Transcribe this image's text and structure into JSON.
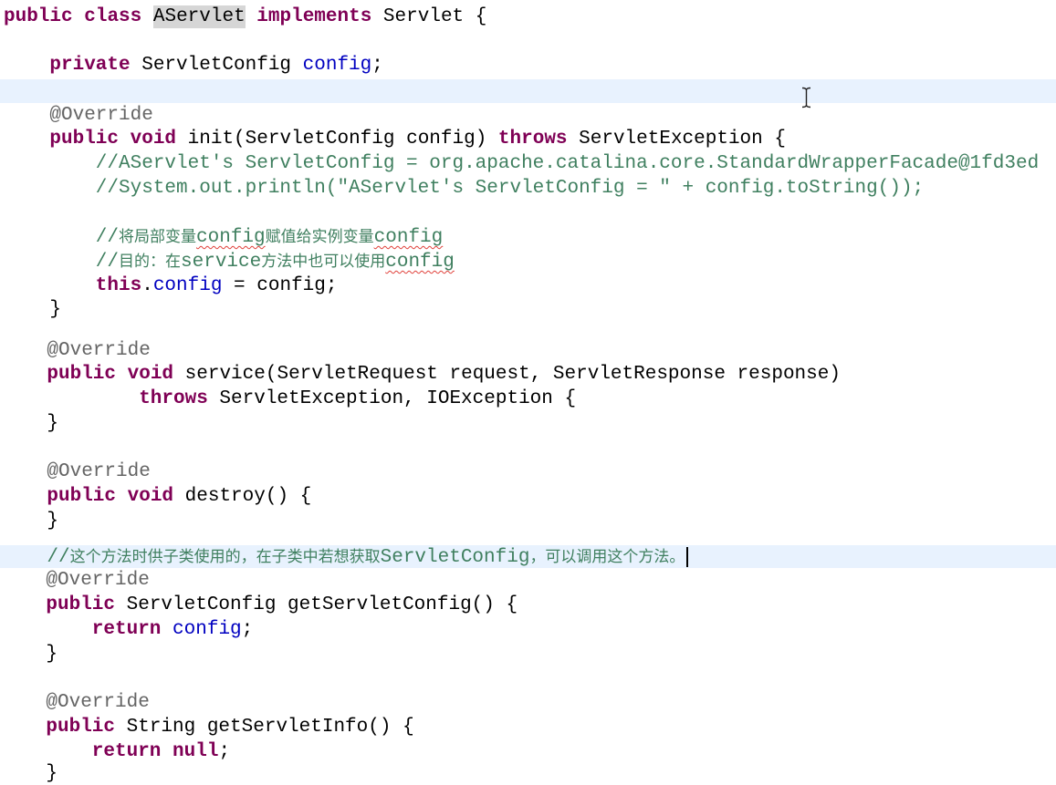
{
  "colors": {
    "keyword": "#7f0055",
    "plain": "#000000",
    "field": "#0000c0",
    "comment": "#3f7f5f",
    "annotation": "#646464",
    "current_line": "#e8f2fe",
    "occurrence_highlight": "#d6d6d6",
    "spell_error": "#e0403a"
  },
  "mouse_cursor_icon": "ibeam-cursor-icon",
  "lines": [
    {
      "tokens": [
        {
          "type": "keyword",
          "text": "public"
        },
        {
          "type": "plain",
          "text": " "
        },
        {
          "type": "keyword",
          "text": "class"
        },
        {
          "type": "plain",
          "text": " "
        },
        {
          "type": "plain",
          "text": "AServlet",
          "mark": true
        },
        {
          "type": "plain",
          "text": " "
        },
        {
          "type": "keyword",
          "text": "implements"
        },
        {
          "type": "plain",
          "text": " Servlet {"
        }
      ]
    },
    {
      "tokens": [
        {
          "type": "keyword",
          "text": "private"
        },
        {
          "type": "plain",
          "text": " ServletConfig "
        },
        {
          "type": "field",
          "text": "config"
        },
        {
          "type": "plain",
          "text": ";"
        }
      ]
    },
    {
      "tokens": [
        {
          "type": "annotation",
          "text": "@Override"
        }
      ]
    },
    {
      "tokens": [
        {
          "type": "keyword",
          "text": "public"
        },
        {
          "type": "plain",
          "text": " "
        },
        {
          "type": "keyword",
          "text": "void"
        },
        {
          "type": "plain",
          "text": " init(ServletConfig config) "
        },
        {
          "type": "keyword",
          "text": "throws"
        },
        {
          "type": "plain",
          "text": " ServletException {"
        }
      ]
    },
    {
      "tokens": [
        {
          "type": "comment",
          "text": "//AServlet's ServletConfig = org.apache.catalina.core.StandardWrapperFacade@1fd3ed"
        }
      ]
    },
    {
      "tokens": [
        {
          "type": "comment",
          "text": "//System.out.println(\"AServlet's ServletConfig = \" + config.toString());"
        }
      ]
    },
    {
      "tokens": [
        {
          "type": "comment",
          "text": "//将局部变量"
        },
        {
          "type": "comment",
          "text": "config",
          "spell_error": true
        },
        {
          "type": "comment",
          "text": "赋值给实例变量"
        },
        {
          "type": "comment",
          "text": "config",
          "spell_error": true
        }
      ]
    },
    {
      "tokens": [
        {
          "type": "comment",
          "text": "//目的：在service方法中也可以使用"
        },
        {
          "type": "comment",
          "text": "config",
          "spell_error": true
        }
      ]
    },
    {
      "tokens": [
        {
          "type": "keyword",
          "text": "this"
        },
        {
          "type": "plain",
          "text": "."
        },
        {
          "type": "field",
          "text": "config"
        },
        {
          "type": "plain",
          "text": " = config;"
        }
      ]
    },
    {
      "tokens": [
        {
          "type": "plain",
          "text": "}"
        }
      ]
    },
    {
      "tokens": [
        {
          "type": "annotation",
          "text": "@Override"
        }
      ]
    },
    {
      "tokens": [
        {
          "type": "keyword",
          "text": "public"
        },
        {
          "type": "plain",
          "text": " "
        },
        {
          "type": "keyword",
          "text": "void"
        },
        {
          "type": "plain",
          "text": " service(ServletRequest request, ServletResponse response)"
        }
      ]
    },
    {
      "tokens": [
        {
          "type": "keyword",
          "text": "throws"
        },
        {
          "type": "plain",
          "text": " ServletException, IOException {"
        }
      ]
    },
    {
      "tokens": [
        {
          "type": "plain",
          "text": "}"
        }
      ]
    },
    {
      "tokens": [
        {
          "type": "annotation",
          "text": "@Override"
        }
      ]
    },
    {
      "tokens": [
        {
          "type": "keyword",
          "text": "public"
        },
        {
          "type": "plain",
          "text": " "
        },
        {
          "type": "keyword",
          "text": "void"
        },
        {
          "type": "plain",
          "text": " destroy() {"
        }
      ]
    },
    {
      "tokens": [
        {
          "type": "plain",
          "text": "}"
        }
      ]
    },
    {
      "tokens": [
        {
          "type": "comment",
          "text": "//这个方法时供子类使用的，在子类中若想获取ServletConfig，可以调用这个方法。"
        }
      ],
      "caret": true
    },
    {
      "tokens": [
        {
          "type": "annotation",
          "text": "@Override"
        }
      ]
    },
    {
      "tokens": [
        {
          "type": "keyword",
          "text": "public"
        },
        {
          "type": "plain",
          "text": " ServletConfig getServletConfig() {"
        }
      ]
    },
    {
      "tokens": [
        {
          "type": "keyword",
          "text": "return"
        },
        {
          "type": "plain",
          "text": " "
        },
        {
          "type": "field",
          "text": "config"
        },
        {
          "type": "plain",
          "text": ";"
        }
      ]
    },
    {
      "tokens": [
        {
          "type": "plain",
          "text": "}"
        }
      ]
    },
    {
      "tokens": [
        {
          "type": "annotation",
          "text": "@Override"
        }
      ]
    },
    {
      "tokens": [
        {
          "type": "keyword",
          "text": "public"
        },
        {
          "type": "plain",
          "text": " String getServletInfo() {"
        }
      ]
    },
    {
      "tokens": [
        {
          "type": "keyword",
          "text": "return"
        },
        {
          "type": "plain",
          "text": " "
        },
        {
          "type": "keyword",
          "text": "null"
        },
        {
          "type": "plain",
          "text": ";"
        }
      ]
    },
    {
      "tokens": [
        {
          "type": "plain",
          "text": "}"
        }
      ]
    }
  ]
}
